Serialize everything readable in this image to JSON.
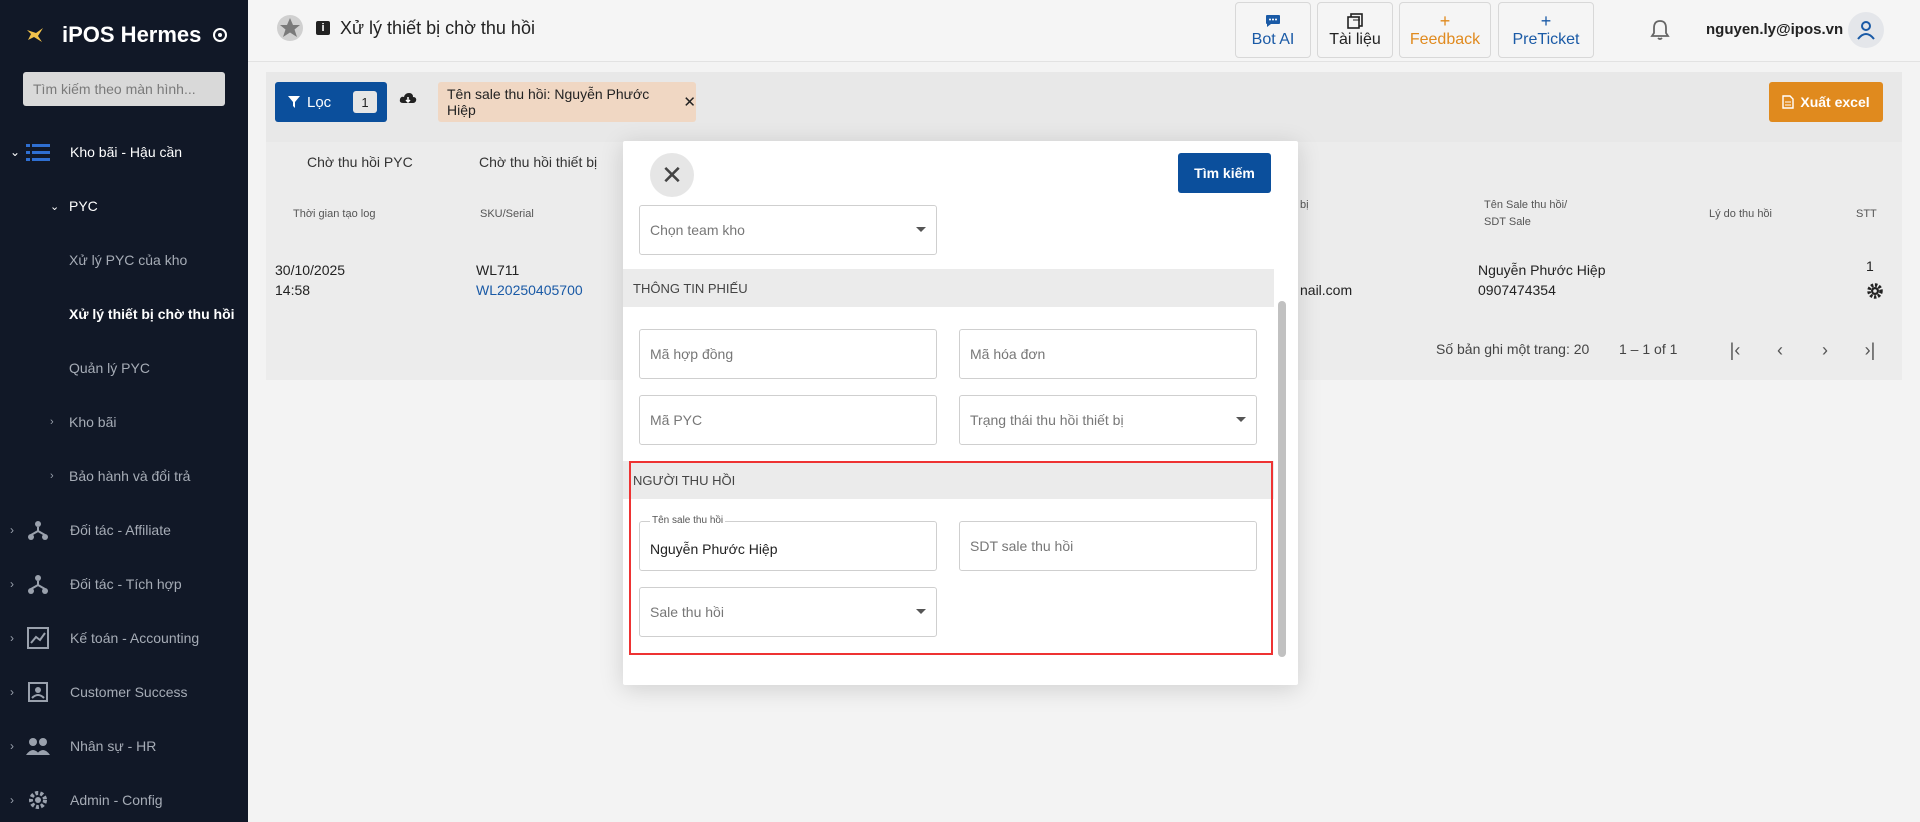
{
  "sidebar": {
    "brand": "iPOS Hermes",
    "search_placeholder": "Tìm kiếm theo màn hình...",
    "groups": [
      {
        "label": "Kho bãi - Hậu cần",
        "icon": "list-icon",
        "expanded": true
      },
      {
        "label": "Đối tác - Affiliate",
        "icon": "network-icon"
      },
      {
        "label": "Đối tác - Tích hợp",
        "icon": "network-icon"
      },
      {
        "label": "Kế toán - Accounting",
        "icon": "chart-icon"
      },
      {
        "label": "Customer Success",
        "icon": "contact-icon"
      },
      {
        "label": "Nhân sự - HR",
        "icon": "people-icon"
      },
      {
        "label": "Admin - Config",
        "icon": "gear-icon"
      }
    ],
    "sub": {
      "pyc": "PYC",
      "xu_ly_pyc": "Xử lý PYC của kho",
      "xu_ly_thiet_bi": "Xử lý thiết bị chờ thu hồi",
      "quan_ly_pyc": "Quản lý PYC",
      "kho_bai": "Kho bãi",
      "bao_hanh": "Bảo hành và đổi trả"
    }
  },
  "header": {
    "title": "Xử lý thiết bị chờ thu hồi",
    "buttons": {
      "bot_ai": "Bot AI",
      "tai_lieu": "Tài liệu",
      "feedback": "Feedback",
      "preticket": "PreTicket"
    },
    "user_email": "nguyen.ly@ipos.vn"
  },
  "filterbar": {
    "filter_label": "Lọc",
    "filter_count": "1",
    "chip_label": "Tên sale thu hồi: Nguyễn Phước Hiệp",
    "export_label": "Xuất excel"
  },
  "table": {
    "tabs": [
      "Chờ thu hồi PYC",
      "Chờ thu hồi thiết bị"
    ],
    "headers": {
      "created": "Thời gian tạo log",
      "sku": "SKU/Serial",
      "b_i": "bị",
      "sale_line1": "Tên Sale thu hồi/",
      "sale_line2": "SDT Sale",
      "reason": "Lý do thu hồi",
      "stt": "STT"
    },
    "row": {
      "date": "30/10/2025",
      "time": "14:58",
      "sku": "WL711",
      "serial": "WL20250405700",
      "email_fragment": "nail.com",
      "sale_name": "Nguyễn Phước Hiệp",
      "sale_phone": "0907474354",
      "stt": "1"
    },
    "pager": {
      "rows_per_page": "Số bản ghi một trang: 20",
      "range": "1 – 1 of 1"
    }
  },
  "modal": {
    "search_label": "Tìm kiếm",
    "team_kho_placeholder": "Chọn team kho",
    "section_phieu": "THÔNG TIN PHIẾU",
    "ma_hop_dong": "Mã hợp đồng",
    "ma_hoa_don": "Mã hóa đơn",
    "ma_pyc": "Mã PYC",
    "trang_thai": "Trạng thái thu hồi thiết bị",
    "section_nguoi": "NGƯỜI THU HỒI",
    "ten_sale_label": "Tên sale thu hồi",
    "ten_sale_value": "Nguyễn Phước Hiệp",
    "sdt_sale": "SDT sale thu hồi",
    "sale_thu_hoi": "Sale thu hồi"
  },
  "colors": {
    "sidebar_bg": "#111827",
    "primary": "#0b4f9c",
    "accent_orange": "#e08a1e",
    "chip_bg": "#f0d7c3",
    "highlight": "#e33333"
  }
}
